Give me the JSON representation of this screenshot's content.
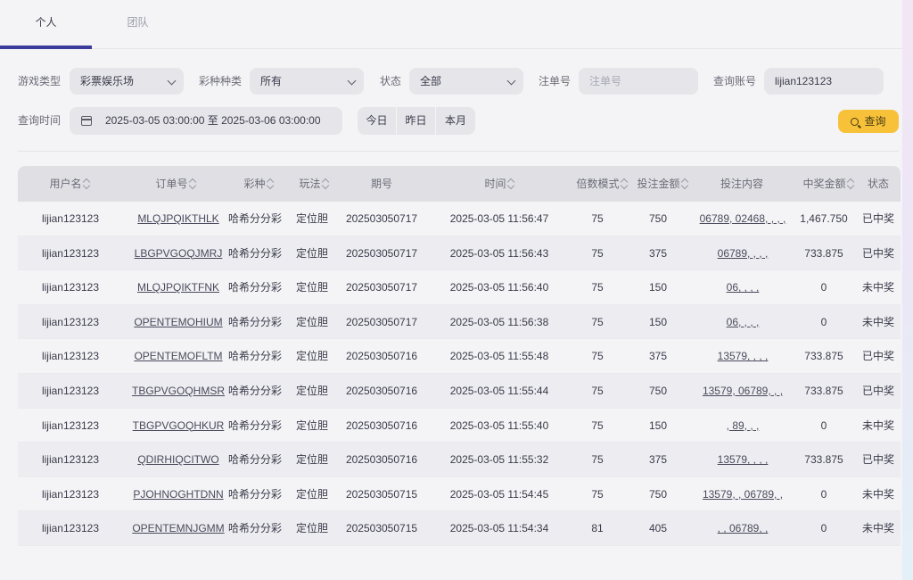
{
  "tabs": [
    {
      "label": "个人"
    },
    {
      "label": "团队"
    }
  ],
  "filters": {
    "game_type_label": "游戏类型",
    "game_type_value": "彩票娱乐场",
    "lottery_kind_label": "彩种种类",
    "lottery_kind_value": "所有",
    "status_label": "状态",
    "status_value": "全部",
    "order_no_label": "注单号",
    "order_no_placeholder": "注单号",
    "account_label": "查询账号",
    "account_value": "lijian123123",
    "time_label": "查询时间",
    "time_range": "2025-03-05 03:00:00 至 2025-03-06 03:00:00",
    "quick": [
      "今日",
      "昨日",
      "本月"
    ],
    "query_button": "查询"
  },
  "table": {
    "headers": [
      "用户名",
      "订单号",
      "彩种",
      "玩法",
      "期号",
      "时间",
      "倍数模式",
      "投注金额",
      "投注内容",
      "中奖金额",
      "状态"
    ],
    "rows": [
      {
        "user": "lijian123123",
        "order": "MLQJPQIKTHLK",
        "lottery": "哈希分分彩",
        "play": "定位胆",
        "issue": "202503050717",
        "time": "2025-03-05 11:56:47",
        "mult": "75",
        "amount": "750",
        "content": "06789, 02468, , , ,",
        "prize": "1,467.750",
        "status": "已中奖"
      },
      {
        "user": "lijian123123",
        "order": "LBGPVGOQJMRJ",
        "lottery": "哈希分分彩",
        "play": "定位胆",
        "issue": "202503050717",
        "time": "2025-03-05 11:56:43",
        "mult": "75",
        "amount": "375",
        "content": "06789, , , ,",
        "prize": "733.875",
        "status": "已中奖"
      },
      {
        "user": "lijian123123",
        "order": "MLQJPQIKTFNK",
        "lottery": "哈希分分彩",
        "play": "定位胆",
        "issue": "202503050717",
        "time": "2025-03-05 11:56:40",
        "mult": "75",
        "amount": "150",
        "content": "06, , , ,",
        "prize": "0",
        "status": "未中奖"
      },
      {
        "user": "lijian123123",
        "order": "OPENTEMOHIUM",
        "lottery": "哈希分分彩",
        "play": "定位胆",
        "issue": "202503050717",
        "time": "2025-03-05 11:56:38",
        "mult": "75",
        "amount": "150",
        "content": "06, , , ,",
        "prize": "0",
        "status": "未中奖"
      },
      {
        "user": "lijian123123",
        "order": "OPENTEMOFLTM",
        "lottery": "哈希分分彩",
        "play": "定位胆",
        "issue": "202503050716",
        "time": "2025-03-05 11:55:48",
        "mult": "75",
        "amount": "375",
        "content": "13579, , , ,",
        "prize": "733.875",
        "status": "已中奖"
      },
      {
        "user": "lijian123123",
        "order": "TBGPVGOQHMSR",
        "lottery": "哈希分分彩",
        "play": "定位胆",
        "issue": "202503050716",
        "time": "2025-03-05 11:55:44",
        "mult": "75",
        "amount": "750",
        "content": "13579, 06789, , ,",
        "prize": "733.875",
        "status": "已中奖"
      },
      {
        "user": "lijian123123",
        "order": "TBGPVGOQHKUR",
        "lottery": "哈希分分彩",
        "play": "定位胆",
        "issue": "202503050716",
        "time": "2025-03-05 11:55:40",
        "mult": "75",
        "amount": "150",
        "content": ", 89, , ,",
        "prize": "0",
        "status": "未中奖"
      },
      {
        "user": "lijian123123",
        "order": "QDIRHIQCITWO",
        "lottery": "哈希分分彩",
        "play": "定位胆",
        "issue": "202503050716",
        "time": "2025-03-05 11:55:32",
        "mult": "75",
        "amount": "375",
        "content": "13579, , , ,",
        "prize": "733.875",
        "status": "已中奖"
      },
      {
        "user": "lijian123123",
        "order": "PJOHNOGHTDNN",
        "lottery": "哈希分分彩",
        "play": "定位胆",
        "issue": "202503050715",
        "time": "2025-03-05 11:54:45",
        "mult": "75",
        "amount": "750",
        "content": "13579, , 06789, ,",
        "prize": "0",
        "status": "未中奖"
      },
      {
        "user": "lijian123123",
        "order": "OPENTEMNJGMM",
        "lottery": "哈希分分彩",
        "play": "定位胆",
        "issue": "202503050715",
        "time": "2025-03-05 11:54:34",
        "mult": "81",
        "amount": "405",
        "content": ", , 06789, ,",
        "prize": "0",
        "status": "未中奖"
      }
    ]
  }
}
